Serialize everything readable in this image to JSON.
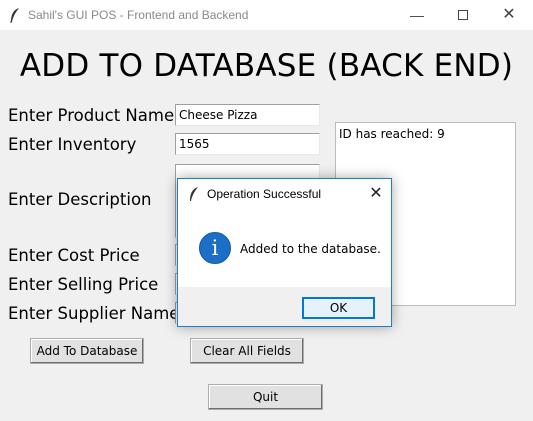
{
  "window": {
    "title": "Sahil's GUI POS - Frontend and Backend"
  },
  "heading": "ADD TO DATABASE (BACK END)",
  "form": {
    "product_name_label": "Enter Product Name",
    "product_name_value": "Cheese Pizza",
    "inventory_label": "Enter Inventory",
    "inventory_value": "1565",
    "description_label": "Enter Description",
    "cost_price_label": "Enter Cost Price",
    "selling_price_label": "Enter Selling Price",
    "supplier_name_label": "Enter Supplier Name"
  },
  "output": {
    "text": "ID has reached: 9"
  },
  "buttons": {
    "add": "Add To Database",
    "clear": "Clear All Fields",
    "quit": "Quit"
  },
  "dialog": {
    "title": "Operation Successful",
    "message": "Added to the database.",
    "ok": "OK",
    "icon": "info-icon"
  },
  "icons": {
    "app": "feather-icon",
    "minimize": "minimize-icon",
    "maximize": "maximize-icon",
    "close": "close-icon"
  }
}
